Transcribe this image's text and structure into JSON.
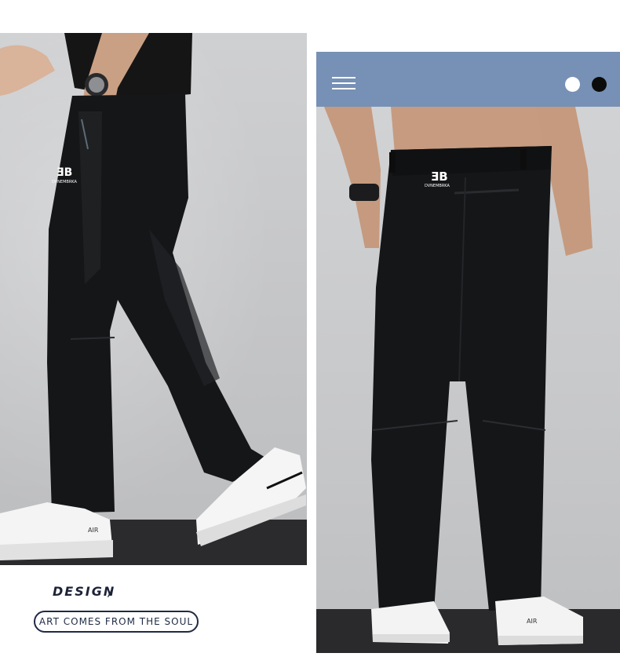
{
  "caption": {
    "design": "DESIGN",
    "slash": "/",
    "tagline": "ART COMES FROM THE SOUL"
  },
  "brand": {
    "logo_text": "DVNEMBRKA",
    "shoe_text": "AIR"
  },
  "swatches": [
    {
      "name": "white",
      "color": "#ffffff"
    },
    {
      "name": "black",
      "color": "#0b0b0b"
    }
  ],
  "colors": {
    "accent_bar": "#7790b5",
    "caption_text": "#1d2236"
  },
  "icons": {
    "menu": "hamburger-menu-icon"
  }
}
